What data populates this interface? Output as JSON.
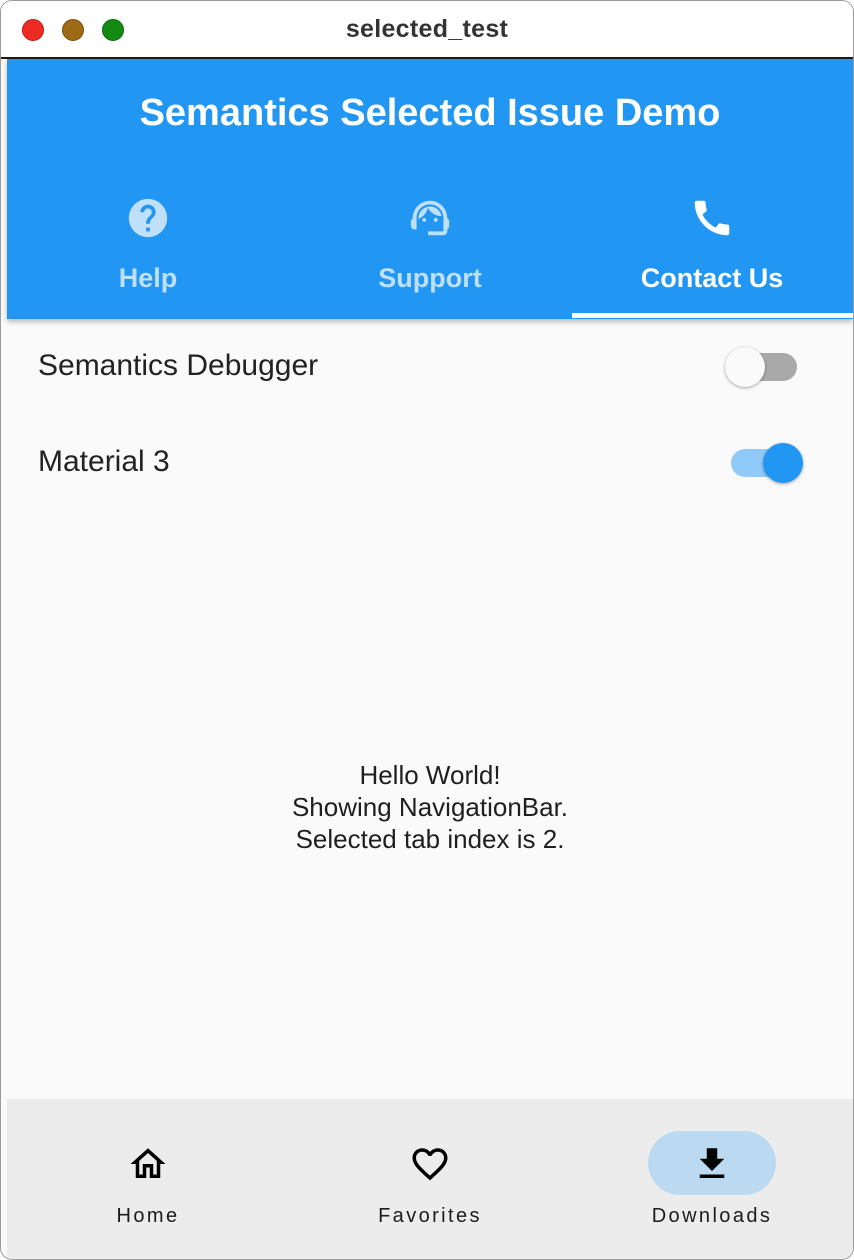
{
  "window": {
    "title": "selected_test"
  },
  "appbar": {
    "title": "Semantics Selected Issue Demo",
    "tabs": [
      {
        "label": "Help",
        "icon": "help-circle-icon",
        "selected": false
      },
      {
        "label": "Support",
        "icon": "support-agent-icon",
        "selected": false
      },
      {
        "label": "Contact Us",
        "icon": "phone-icon",
        "selected": true
      }
    ]
  },
  "settings": {
    "semantics_debugger": {
      "label": "Semantics Debugger",
      "on": false
    },
    "material3": {
      "label": "Material 3",
      "on": true
    }
  },
  "body_text": {
    "line1": "Hello World!",
    "line2": "Showing NavigationBar.",
    "line3": "Selected tab index is 2."
  },
  "navbar": {
    "items": [
      {
        "label": "Home",
        "icon": "home-icon",
        "selected": false
      },
      {
        "label": "Favorites",
        "icon": "heart-icon",
        "selected": false
      },
      {
        "label": "Downloads",
        "icon": "download-icon",
        "selected": true
      }
    ]
  },
  "colors": {
    "primary": "#2196f3",
    "tab_inactive": "#bfe0fb",
    "switch_off_track": "#a9a9a9",
    "switch_on_track": "#90caf9",
    "nav_indicator": "#bbdaf2",
    "nav_background": "#ececec"
  }
}
